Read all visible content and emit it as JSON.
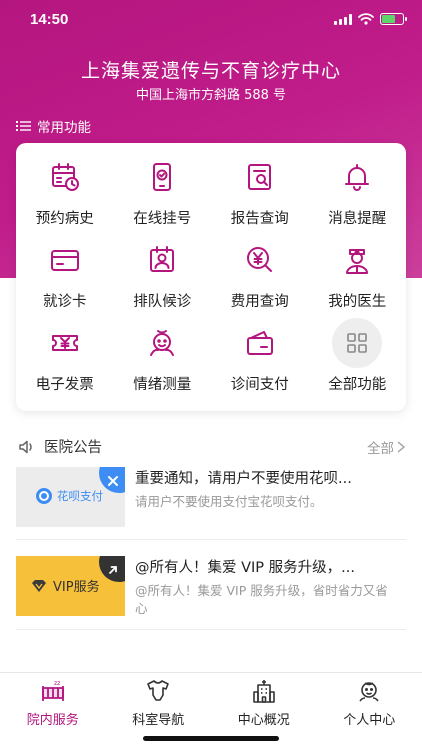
{
  "status_bar": {
    "time": "14:50"
  },
  "header": {
    "hospital_name": "上海集爱遗传与不育诊疗中心",
    "address": "中国上海市方斜路 588 号"
  },
  "common_functions": {
    "title": "常用功能",
    "items": [
      {
        "label": "预约病史",
        "icon": "calendar-clock-icon"
      },
      {
        "label": "在线挂号",
        "icon": "phone-check-icon"
      },
      {
        "label": "报告查询",
        "icon": "report-search-icon"
      },
      {
        "label": "消息提醒",
        "icon": "bell-icon"
      },
      {
        "label": "就诊卡",
        "icon": "card-icon"
      },
      {
        "label": "排队候诊",
        "icon": "queue-id-icon"
      },
      {
        "label": "费用查询",
        "icon": "yen-search-icon"
      },
      {
        "label": "我的医生",
        "icon": "doctor-icon"
      },
      {
        "label": "电子发票",
        "icon": "yen-ticket-icon"
      },
      {
        "label": "情绪测量",
        "icon": "mood-face-icon"
      },
      {
        "label": "诊间支付",
        "icon": "wallet-icon"
      },
      {
        "label": "全部功能",
        "icon": "grid-icon"
      }
    ]
  },
  "announcements": {
    "title": "医院公告",
    "more_label": "全部",
    "items": [
      {
        "title": "重要通知，请用户不要使用花呗...",
        "summary": "请用户不要使用支付宝花呗支付。",
        "thumb_text": "花呗支付",
        "thumb_bg": "#ececec",
        "badge_color": "#3d8df5"
      },
      {
        "title": "@所有人！集爱 VIP 服务升级，...",
        "summary": "@所有人！集爱 VIP 服务升级，省时省力又省心",
        "thumb_text": "VIP服务",
        "thumb_bg": "#f7c03a",
        "badge_color": "#333333"
      }
    ]
  },
  "tab_bar": {
    "active_index": 0,
    "tabs": [
      {
        "label": "院内服务",
        "icon": "crib-icon"
      },
      {
        "label": "科室导航",
        "icon": "onesie-icon"
      },
      {
        "label": "中心概况",
        "icon": "building-icon"
      },
      {
        "label": "个人中心",
        "icon": "baby-face-icon"
      }
    ]
  },
  "colors": {
    "primary": "#b4167f",
    "text": "#222222",
    "muted": "#999999"
  }
}
